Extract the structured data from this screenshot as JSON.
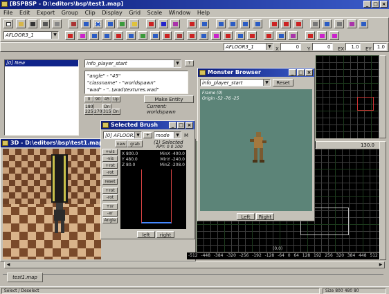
{
  "app": {
    "title": "BSP - D:\\editors\\bsp\\test1.map]",
    "title_prefix": "[BSP"
  },
  "menu": [
    "File",
    "Edit",
    "Export",
    "Group",
    "Clip",
    "Display",
    "Grid",
    "Scale",
    "Window",
    "Help"
  ],
  "toolbar": {
    "texture_select": "AFLOOR3_1",
    "texture_select_right": "AFLOOR3_1",
    "coord_labels": [
      "X",
      "Y",
      "EX",
      "EY"
    ],
    "coord_values": [
      "0",
      "0",
      "1.0",
      "1.0"
    ]
  },
  "entity_panel": {
    "list_selected": "[0] New",
    "classname_field": "info_player_start",
    "keys": [
      "\"angle\" - \"45\"",
      "\"classname\" - \"worldspawn\"",
      "\"wad\" - \"..\\wad\\textures.wad\""
    ],
    "make_entity": "Make Entity",
    "current_label": "Current: worldspawn",
    "angle_buttons": [
      "0",
      "90",
      "45",
      "Up"
    ],
    "angle_buttons2": [
      "180",
      "Dn"
    ],
    "angle_buttons3": [
      "225",
      "270",
      "315",
      "Dn"
    ]
  },
  "view3d": {
    "title": "3D - D:\\editors\\bsp\\test1.map"
  },
  "selected_brush": {
    "title": "Selected Brush",
    "select": "[0] AFLOOR3_1",
    "mode": "mode",
    "mode_short": "M",
    "new_label": "new",
    "grab_label": "grab",
    "selected_info": "(1) Selected",
    "rpy": "RPY: 0 0 100",
    "side_buttons": [
      "+vis",
      "-vis",
      "+rot",
      "-rot",
      "reset",
      "+rot",
      "-rot",
      "+xr",
      "-xr",
      "Angle"
    ],
    "x_label": "X 800.0",
    "y_label": "Y 480.0",
    "z_label": "Z 80.0",
    "minx": "MinX -400.0",
    "miny": "MinY -240.0",
    "minz": "MinZ -208.0",
    "left": "left",
    "right": "right"
  },
  "monster_browser": {
    "title": "Monster Browser",
    "select": "info_player_start",
    "reset": "Reset",
    "info_line1": "Frame (0)",
    "info_line2": "Origin -52 -76 -25",
    "left": "Left",
    "right": "Right"
  },
  "top_grid": {
    "num": "130.0"
  },
  "bottom_grid": {
    "ruler": [
      "-512",
      "-448",
      "-384",
      "-320",
      "-256",
      "-192",
      "-128",
      "-64",
      "0",
      "64",
      "128",
      "192",
      "256",
      "320",
      "384",
      "448",
      "512"
    ],
    "coord_label": "(0,0)"
  },
  "tab": {
    "label": "test1.map"
  },
  "status": {
    "left": "Select / Deselect",
    "right": "Size 800 480 80"
  },
  "colors": {
    "title_start": "#0d1d7a",
    "title_end": "#3a5bc8",
    "grid_major": "#1c3a1c",
    "monster_bg": "#5c8478"
  }
}
